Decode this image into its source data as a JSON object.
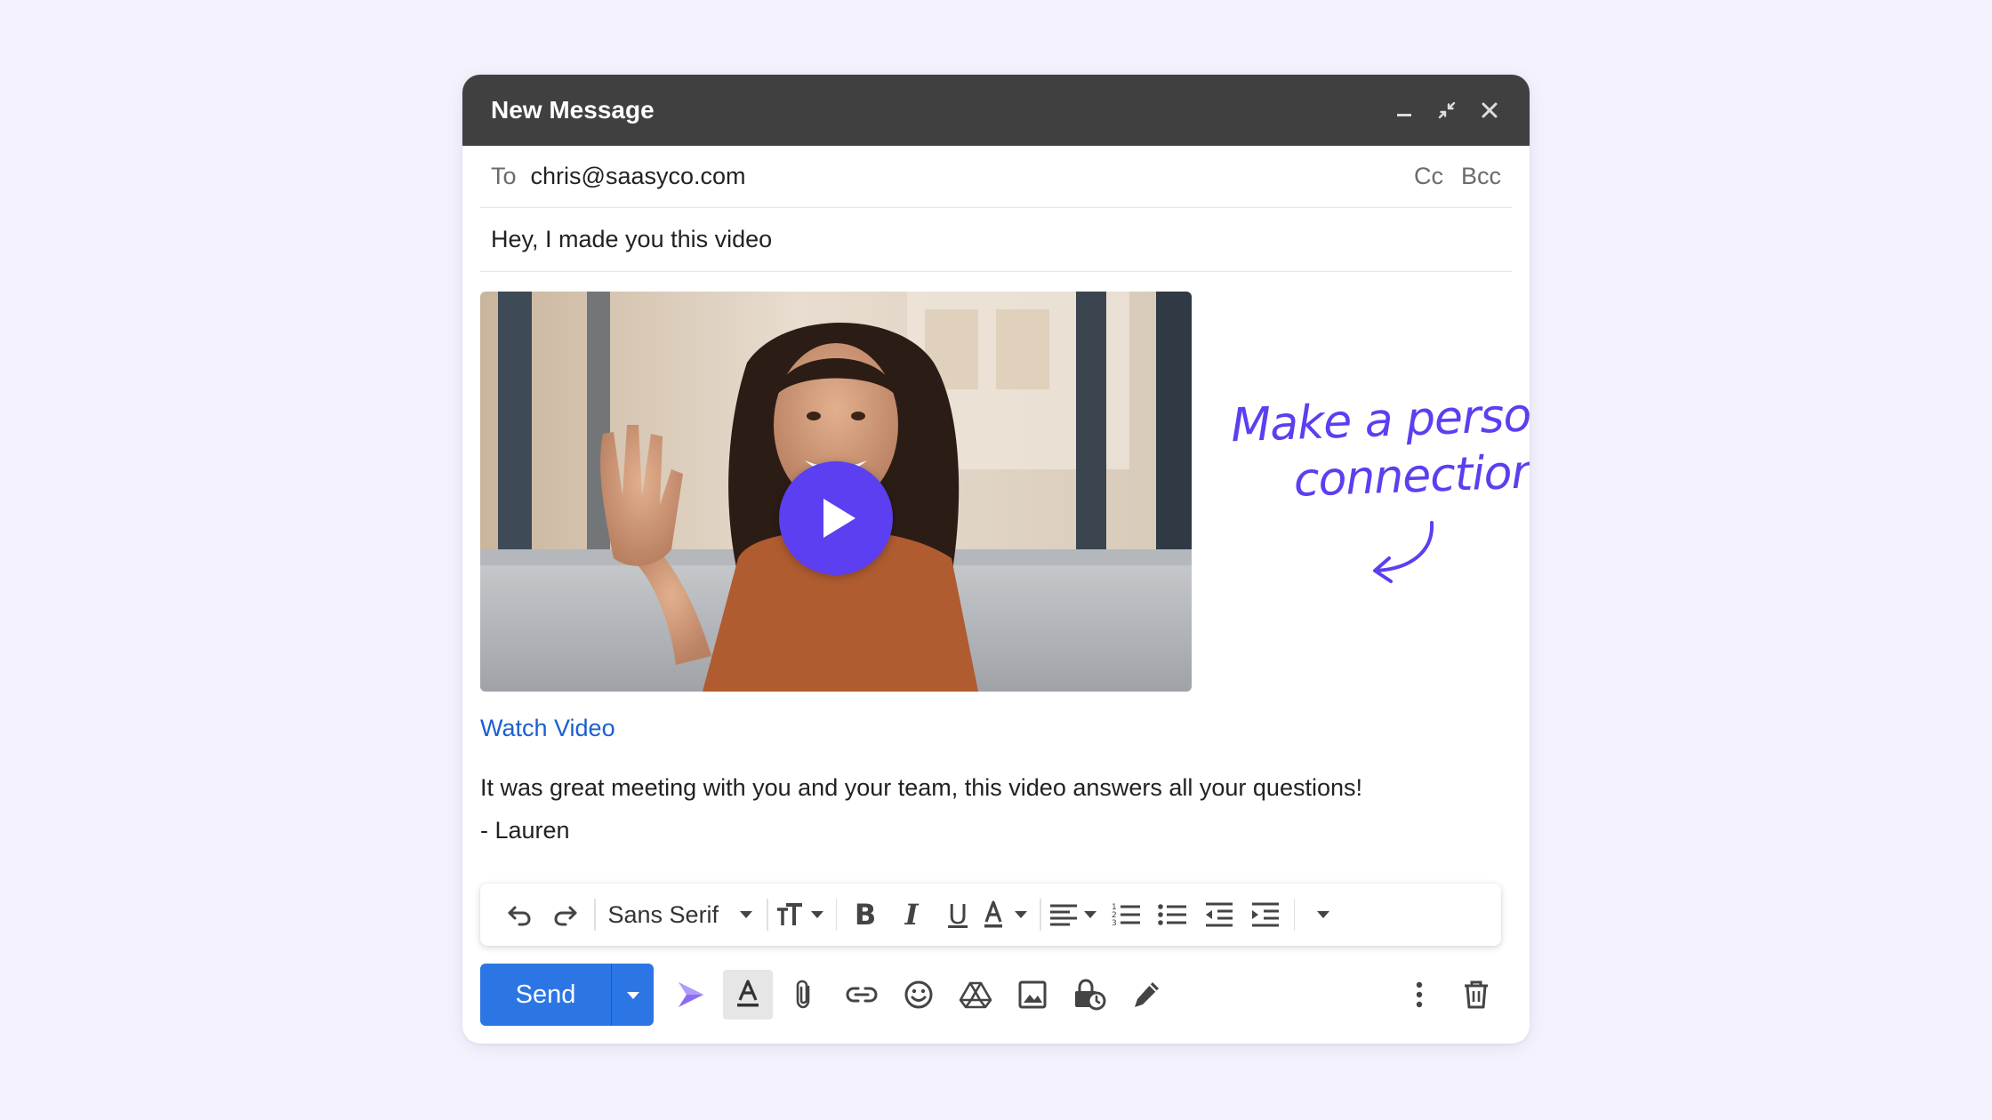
{
  "window": {
    "title": "New Message"
  },
  "recipients": {
    "to_label": "To",
    "to_value": "chris@saasyco.com",
    "cc_label": "Cc",
    "bcc_label": "Bcc"
  },
  "subject": "Hey, I made you this video",
  "video": {
    "link_label": "Watch Video"
  },
  "annotation": {
    "line1": "Make a personal",
    "line2": "connection"
  },
  "body": {
    "line1": "It was great meeting with you and your team, this video answers all your questions!",
    "line2": "- Lauren"
  },
  "toolbar": {
    "font_name": "Sans Serif",
    "bold_label": "B",
    "italic_label": "I",
    "underline_label": "U"
  },
  "actions": {
    "send_label": "Send"
  },
  "colors": {
    "titlebar": "#404040",
    "accent": "#5b3ff0",
    "send": "#2b76e4",
    "link": "#1a5fd0"
  }
}
